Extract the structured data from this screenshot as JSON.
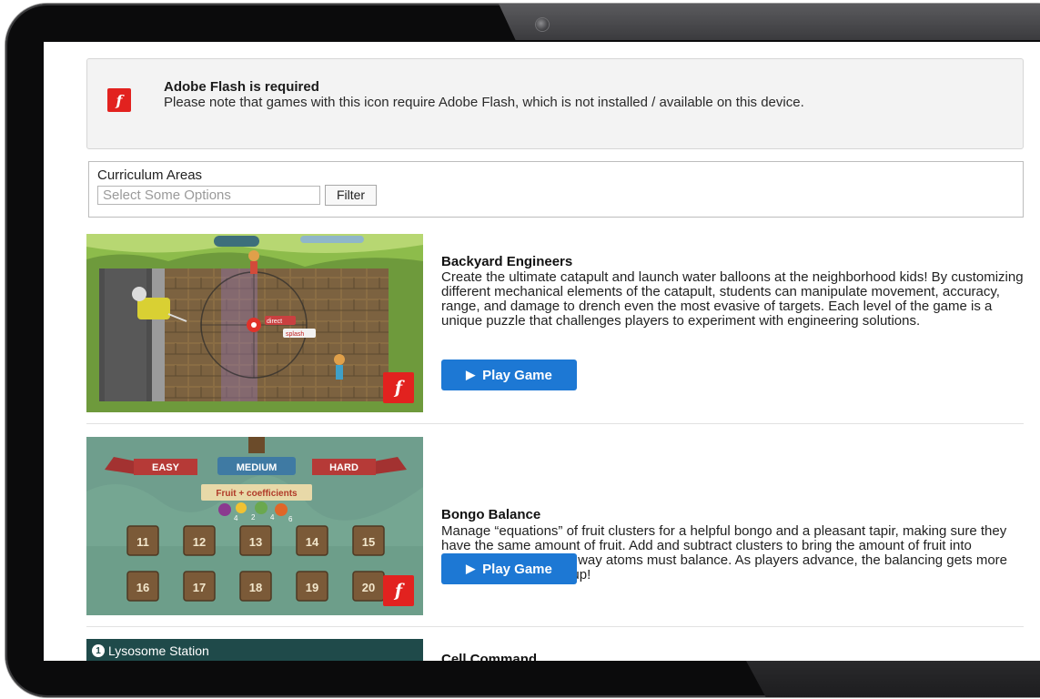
{
  "notice": {
    "icon_letter": "f",
    "title": "Adobe Flash is required",
    "text": "Please note that games with this icon require Adobe Flash, which is not installed / available on this device."
  },
  "filter": {
    "label": "Curriculum Areas",
    "placeholder": "Select Some Options",
    "button": "Filter"
  },
  "games": [
    {
      "title": "Backyard Engineers",
      "description": "Create the ultimate catapult and launch water balloons at the neighborhood kids! By customizing different mechanical elements of the catapult, students can manipulate movement, accuracy, range, and damage to drench even the most evasive of targets. Each level of the game is a unique puzzle that challenges players to experiment with engineering solutions.",
      "play_label": "Play Game",
      "flash_letter": "f",
      "thumb_labels": [
        "direct",
        "splash"
      ]
    },
    {
      "title": "Bongo Balance",
      "description": "Manage “equations” of fruit clusters for a helpful bongo and a pleasant tapir, making sure they have the same amount of fruit. Add and subtract clusters to bring the amount of fruit into balance, similar to the way atoms must balance. As players advance, the balancing gets more complex - try to keep up!",
      "play_label": "Play Game",
      "flash_letter": "f",
      "thumb_labels": {
        "tabs": [
          "EASY",
          "MEDIUM",
          "HARD"
        ],
        "banner": "Fruit + coefficients",
        "coefficients": [
          "4",
          "2",
          "4",
          "6"
        ],
        "levels": [
          "11",
          "12",
          "13",
          "14",
          "15",
          "16",
          "17",
          "18",
          "19",
          "20"
        ]
      }
    },
    {
      "title": "Cell Command",
      "thumb_labels": {
        "station": "Lysosome Station",
        "step": "1"
      }
    }
  ],
  "colors": {
    "flash_red": "#e2221f",
    "play_blue": "#1d78d4"
  }
}
